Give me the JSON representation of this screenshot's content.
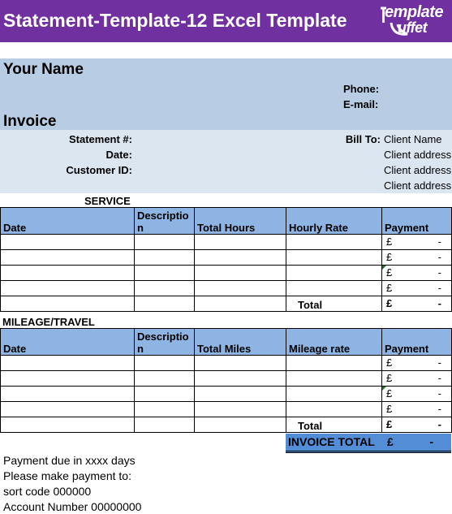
{
  "banner": {
    "title": "Statement-Template-12 Excel Template",
    "logo_line1": "emplate",
    "logo_line2": "uffet",
    "color": "#7030a0"
  },
  "header": {
    "name": "Your Name",
    "phone_label": "Phone:",
    "email_label": "E-mail:",
    "invoice_title": "Invoice",
    "statement_label": "Statement #:",
    "date_label": "Date:",
    "customer_label": "Customer ID:",
    "bill_to_label": "Bill To:",
    "client_name": "Client Name",
    "client_addresses": [
      "Client address",
      "Client address",
      "Client address"
    ]
  },
  "service": {
    "section_title": "SERVICE",
    "columns": [
      "Date",
      "Descriptio n",
      "Total Hours",
      "Hourly Rate",
      "Payment"
    ],
    "rows": [
      {
        "currency": "£",
        "payment": "-"
      },
      {
        "currency": "£",
        "payment": "-"
      },
      {
        "currency": "£",
        "payment": "-"
      },
      {
        "currency": "£",
        "payment": "-"
      }
    ],
    "total_label": "Total",
    "total_currency": "£",
    "total_value": "-"
  },
  "mileage": {
    "section_title": "MILEAGE/TRAVEL",
    "columns": [
      "Date",
      "Descriptio n",
      "Total Miles",
      "Mileage rate",
      "Payment"
    ],
    "rows": [
      {
        "currency": "£",
        "payment": "-"
      },
      {
        "currency": "£",
        "payment": "-"
      },
      {
        "currency": "£",
        "payment": "-"
      },
      {
        "currency": "£",
        "payment": "-"
      }
    ],
    "total_label": "Total",
    "total_currency": "£",
    "total_value": "-"
  },
  "invoice_total": {
    "label": "INVOICE TOTAL",
    "currency": "£",
    "value": "-"
  },
  "footer": [
    "Payment due in xxxx days",
    "Please make payment to:",
    "sort code 000000",
    "Account Number 00000000"
  ],
  "colors": {
    "header_band": "#b8cce4",
    "info_band": "#dce6f1",
    "table_header": "#8db4e2",
    "total_bar": "#538dd5"
  }
}
